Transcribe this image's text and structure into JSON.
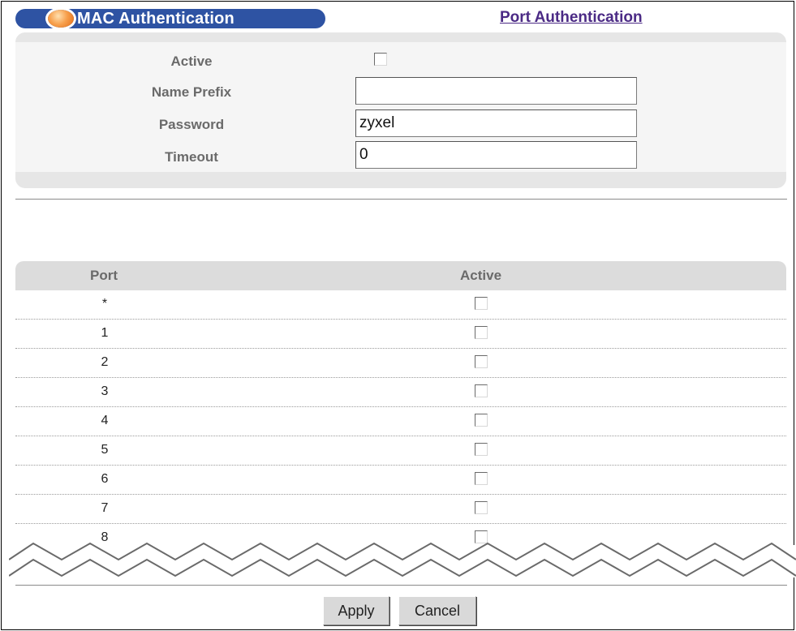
{
  "header": {
    "title": "MAC Authentication",
    "link_label": "Port Authentication"
  },
  "settings": {
    "active_label": "Active",
    "active_checked": false,
    "name_prefix_label": "Name Prefix",
    "name_prefix_value": "",
    "password_label": "Password",
    "password_value": "zyxel",
    "timeout_label": "Timeout",
    "timeout_value": "0"
  },
  "table": {
    "headers": {
      "port": "Port",
      "active": "Active"
    },
    "rows": [
      {
        "port": "*",
        "active": false
      },
      {
        "port": "1",
        "active": false
      },
      {
        "port": "2",
        "active": false
      },
      {
        "port": "3",
        "active": false
      },
      {
        "port": "4",
        "active": false
      },
      {
        "port": "5",
        "active": false
      },
      {
        "port": "6",
        "active": false
      },
      {
        "port": "7",
        "active": false
      },
      {
        "port": "8",
        "active": false
      }
    ]
  },
  "buttons": {
    "apply": "Apply",
    "cancel": "Cancel"
  },
  "colors": {
    "title_bar": "#2e53a3",
    "link": "#4b2a85",
    "panel": "#e6e6e6"
  }
}
